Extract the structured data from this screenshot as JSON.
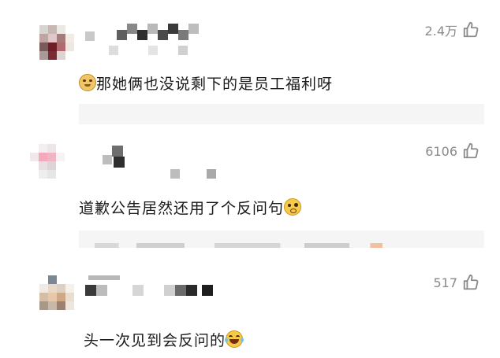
{
  "comments": [
    {
      "likes": "2.4万",
      "text_before": "",
      "text_after": "那她俩也没说剩下的是员工福利呀",
      "emoji": "doge-emoji"
    },
    {
      "likes": "6106",
      "text_before": "道歉公告居然还用了个反问句",
      "text_after": "",
      "emoji": "doubt-emoji"
    },
    {
      "likes": "517",
      "text_before": "头一次见到会反问的",
      "text_after": "",
      "emoji": "laugh-emoji"
    }
  ],
  "icons": {
    "like": "thumbs-up-icon"
  },
  "colors": {
    "meta_text": "#8a8a8a",
    "body_text": "#1a1a1a",
    "reply_bg": "#f5f5f5",
    "emoji_yellow": "#f7c948"
  }
}
